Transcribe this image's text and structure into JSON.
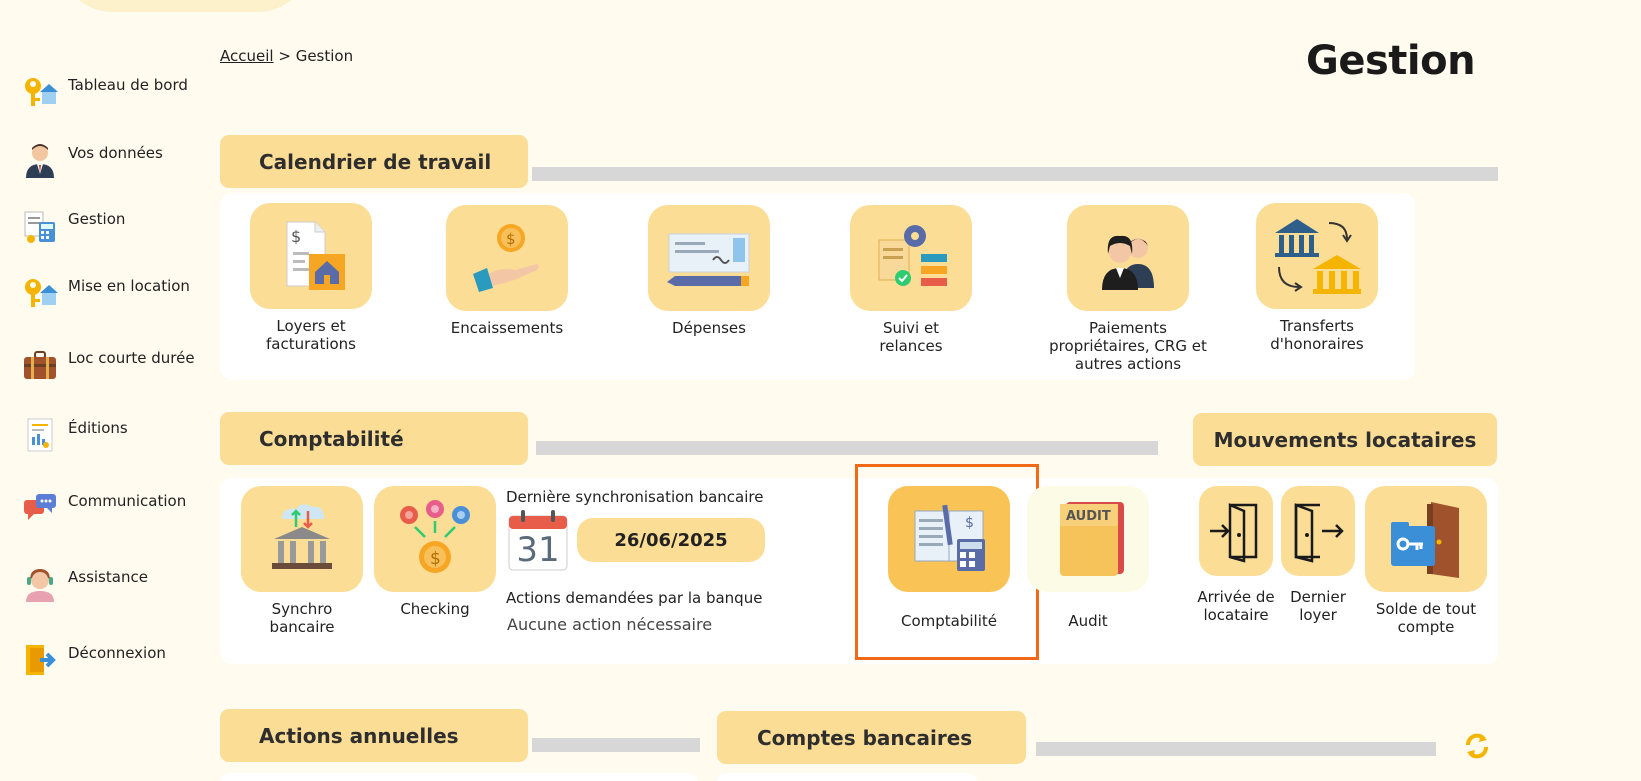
{
  "breadcrumb": {
    "home": "Accueil",
    "separator": ">",
    "current": "Gestion"
  },
  "page_title": "Gestion",
  "sidebar": {
    "items": [
      {
        "label": "Tableau de bord",
        "icon": "house-key-icon"
      },
      {
        "label": "Vos données",
        "icon": "user-profile-icon"
      },
      {
        "label": "Gestion",
        "icon": "calculator-documents-icon"
      },
      {
        "label": "Mise en location",
        "icon": "house-key-icon"
      },
      {
        "label": "Loc courte durée",
        "icon": "suitcase-icon"
      },
      {
        "label": "Éditions",
        "icon": "report-document-icon"
      },
      {
        "label": "Communication",
        "icon": "chat-bubbles-icon"
      },
      {
        "label": "Assistance",
        "icon": "support-agent-icon"
      },
      {
        "label": "Déconnexion",
        "icon": "logout-door-icon"
      }
    ]
  },
  "calendrier": {
    "title": "Calendrier de travail",
    "tiles": [
      {
        "label": "Loyers et facturations",
        "icon": "invoice-house-icon"
      },
      {
        "label": "Encaissements",
        "icon": "hand-coin-icon"
      },
      {
        "label": "Dépenses",
        "icon": "cheque-pen-icon"
      },
      {
        "label": "Suivi et relances",
        "icon": "gear-checklist-icon"
      },
      {
        "label": "Paiements propriétaires, CRG et autres actions",
        "icon": "owners-icon"
      },
      {
        "label": "Transferts d'honoraires",
        "icon": "bank-transfer-icon"
      }
    ]
  },
  "comptabilite": {
    "title": "Comptabilité",
    "tiles": [
      {
        "label": "Synchro bancaire",
        "icon": "bank-sync-icon"
      },
      {
        "label": "Checking",
        "icon": "coin-network-icon"
      },
      {
        "label": "Comptabilité",
        "icon": "ledger-calculator-icon"
      },
      {
        "label": "Audit",
        "icon": "audit-folder-icon"
      }
    ],
    "sync": {
      "label": "Dernière synchronisation bancaire",
      "calendar_day": "31",
      "date": "26/06/2025",
      "actions_label": "Actions demandées par la banque",
      "actions_value": "Aucune action nécessaire"
    }
  },
  "mouvements": {
    "title": "Mouvements locataires",
    "tiles": [
      {
        "label": "Arrivée de locataire",
        "icon": "door-enter-icon"
      },
      {
        "label": "Dernier loyer",
        "icon": "door-exit-icon"
      },
      {
        "label": "Solde de tout compte",
        "icon": "key-folder-door-icon"
      }
    ]
  },
  "actions_annuelles": {
    "title": "Actions annuelles"
  },
  "comptes_bancaires": {
    "title": "Comptes bancaires"
  },
  "colors": {
    "accent": "#fcdd95",
    "highlight": "#f26a17",
    "background": "#fffbef"
  }
}
